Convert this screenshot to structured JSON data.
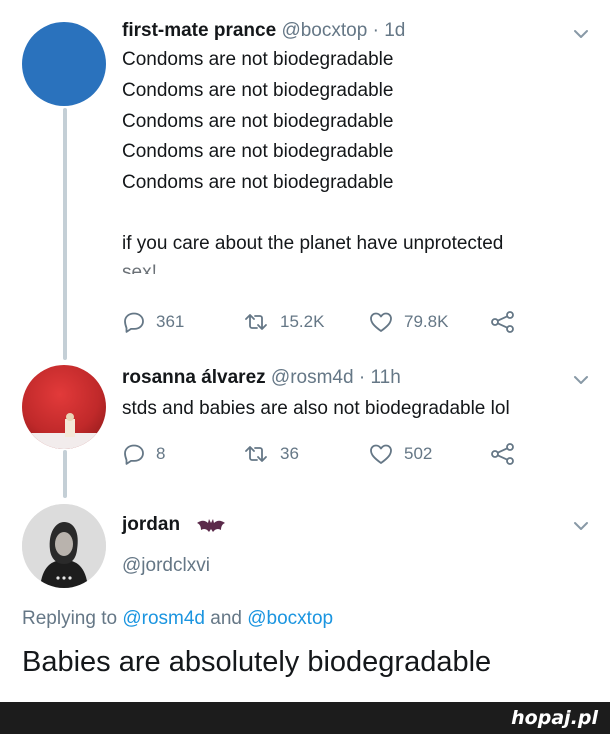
{
  "colors": {
    "avatar1": "#2a72bd",
    "avatar2": "#c0292a",
    "thread_line": "#c4cfd6",
    "mention": "#1b95e0",
    "muted": "#657786",
    "footer_bg": "#1c1c1c"
  },
  "tweet1": {
    "name": "first-mate prance",
    "handle": "@bocxtop",
    "dot": "·",
    "time": "1d",
    "lines": [
      "Condoms are not biodegradable",
      "Condoms are not biodegradable",
      "Condoms are not biodegradable",
      "Condoms are not biodegradable",
      "Condoms are not biodegradable",
      "if you care about the planet have unprotected",
      "sex!"
    ],
    "replies": "361",
    "retweets": "15.2K",
    "likes": "79.8K"
  },
  "tweet2": {
    "name": "rosanna álvarez",
    "handle": "@rosm4d",
    "dot": "·",
    "time": "11h",
    "text": "stds and babies are also not biodegradable lol",
    "replies": "8",
    "retweets": "36",
    "likes": "502"
  },
  "tweet3": {
    "name": "jordan",
    "handle": "@jordclxvi",
    "replying_prefix": "Replying to",
    "mention1": "@rosm4d",
    "and": "and",
    "mention2": "@bocxtop",
    "text": "Babies are absolutely biodegradable"
  },
  "footer": {
    "brand": "hopaj.pl"
  },
  "icons": [
    "chevron-down-icon",
    "reply-icon",
    "retweet-icon",
    "like-icon",
    "share-icon",
    "bat-emoji-icon"
  ]
}
